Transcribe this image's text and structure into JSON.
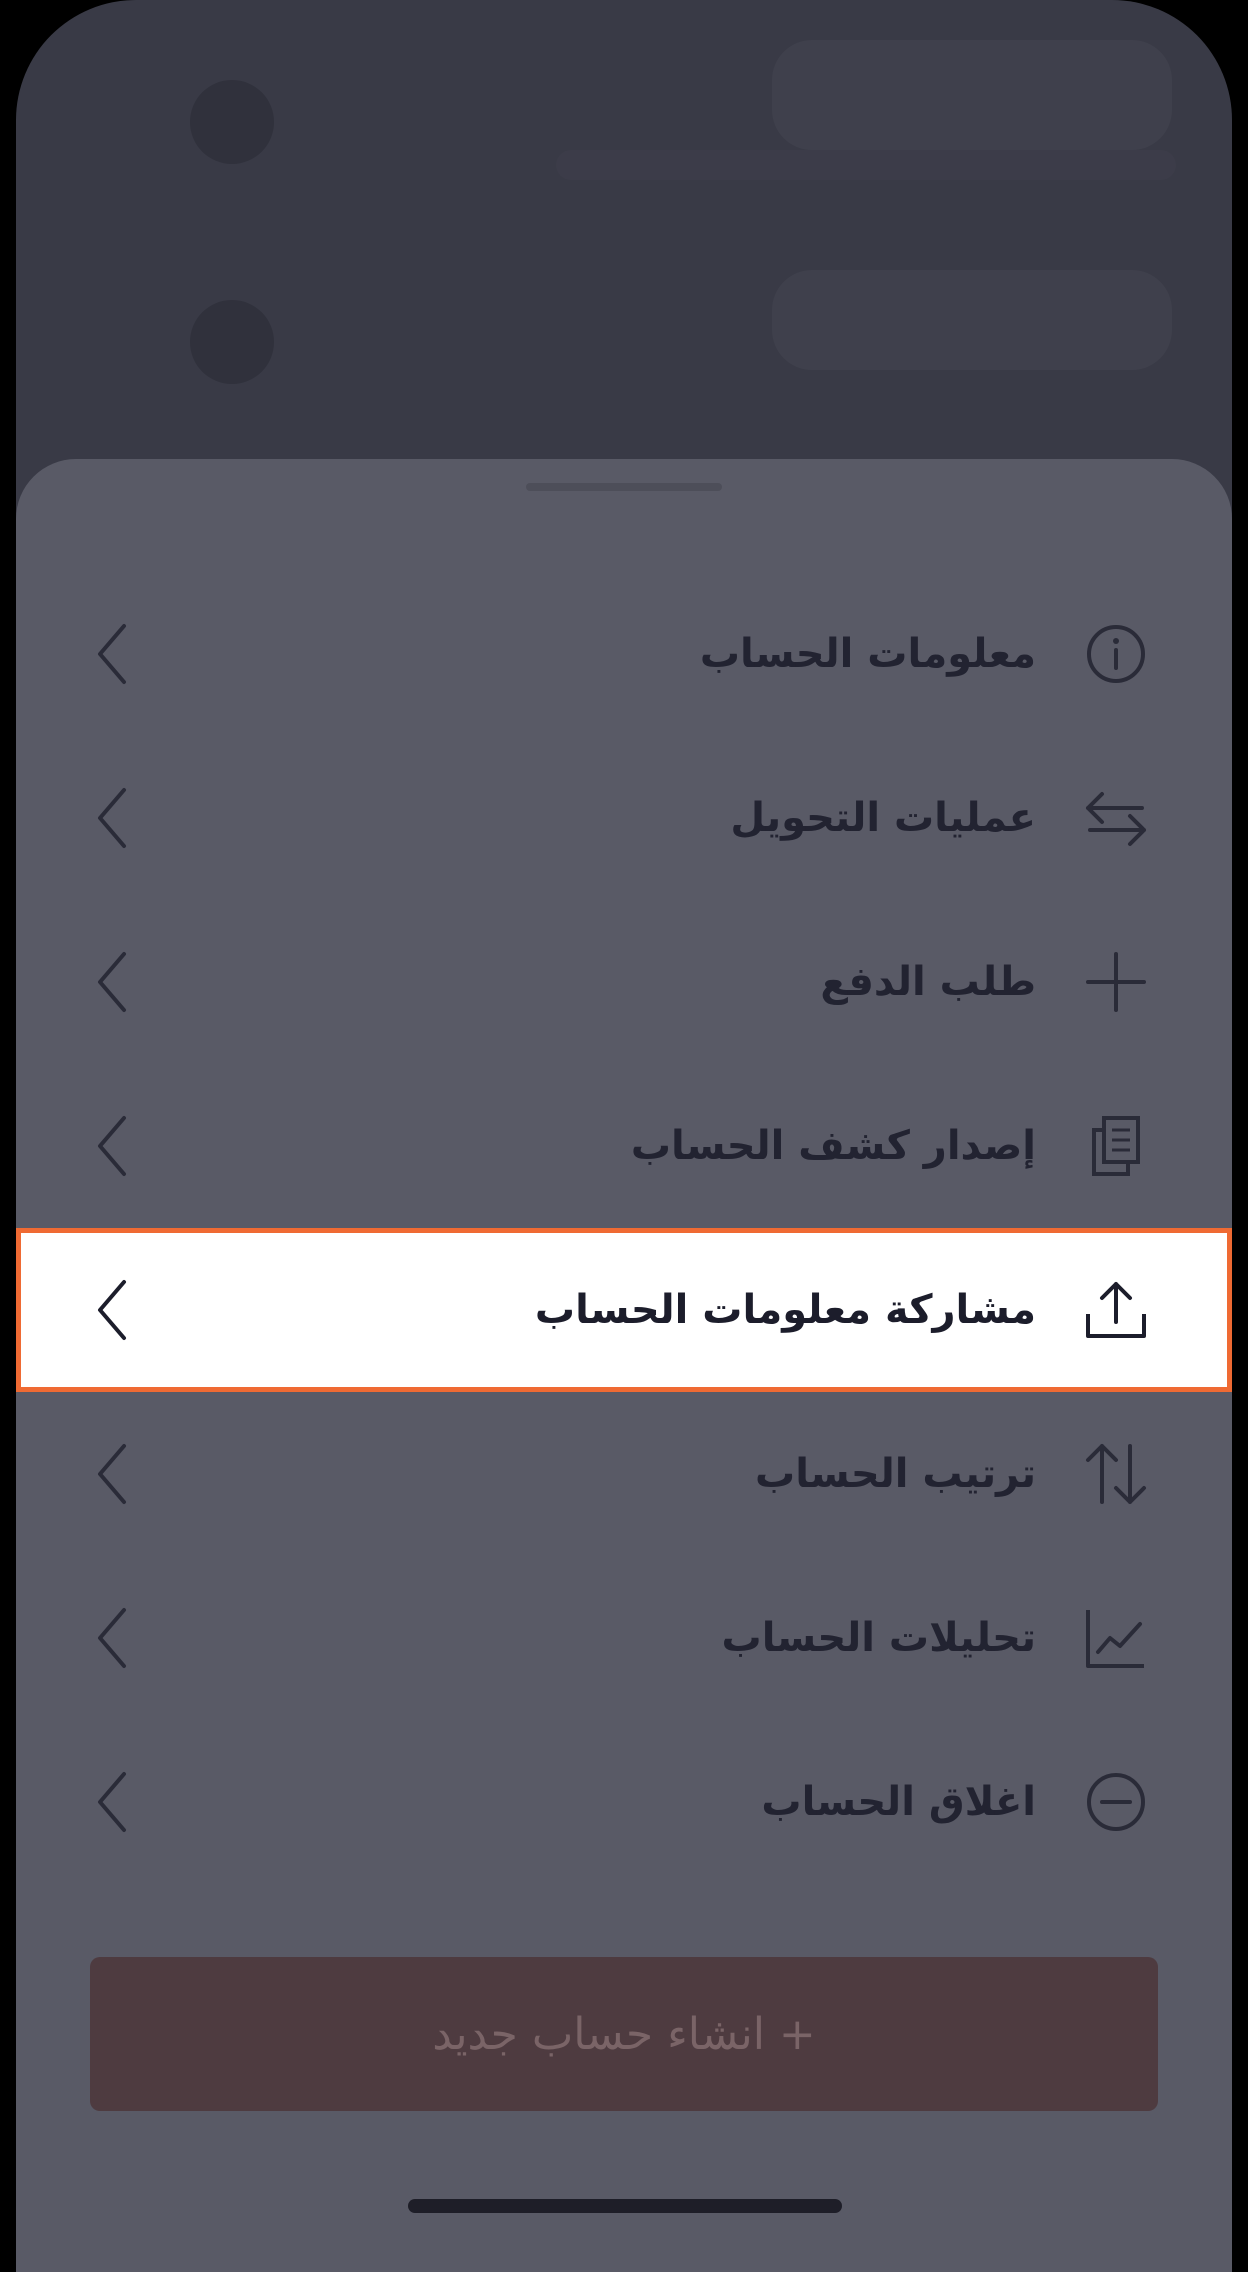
{
  "menu": {
    "items": [
      {
        "label": "معلومات الحساب",
        "icon": "info-icon"
      },
      {
        "label": "عمليات التحويل",
        "icon": "transfer-arrows-icon"
      },
      {
        "label": "طلب الدفع",
        "icon": "plus-icon"
      },
      {
        "label": "إصدار كشف الحساب",
        "icon": "documents-icon"
      },
      {
        "label": "مشاركة معلومات الحساب",
        "icon": "share-upload-icon",
        "highlighted": true
      },
      {
        "label": "ترتيب الحساب",
        "icon": "sort-arrows-icon"
      },
      {
        "label": "تحليلات الحساب",
        "icon": "chart-icon"
      },
      {
        "label": "اغلاق الحساب",
        "icon": "minus-circle-icon"
      }
    ]
  },
  "cta": {
    "label": "+ انشاء حساب جديد"
  },
  "colors": {
    "highlight_border": "#ef6a33",
    "sheet": "#595a66",
    "text": "#222331"
  }
}
